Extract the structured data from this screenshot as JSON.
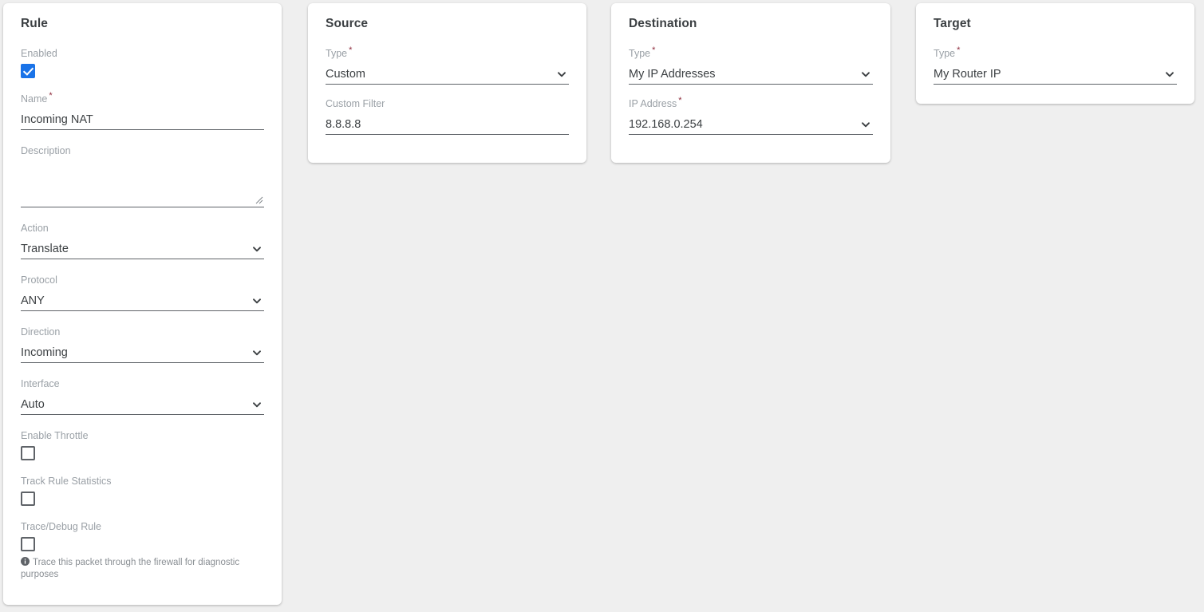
{
  "theme": {
    "page_background": "#efefef",
    "card_background": "#ffffff",
    "accent_checkbox": "#1a73e8",
    "label_color": "#9aa0a6",
    "value_color": "#3c4043",
    "required_asterisk": "#8e2b3c",
    "underline_color": "#5f6368"
  },
  "required_marker": "*",
  "cards": {
    "rule": {
      "title": "Rule",
      "enabled": {
        "label": "Enabled",
        "checked": true,
        "icon": "checkbox-checked-icon"
      },
      "name": {
        "label": "Name",
        "required": true,
        "value": "Incoming NAT"
      },
      "description": {
        "label": "Description",
        "required": false,
        "value": "",
        "resize_handle_icon": "resize-handle-icon"
      },
      "action": {
        "label": "Action",
        "required": false,
        "value": "Translate",
        "icon": "chevron-down-icon"
      },
      "protocol": {
        "label": "Protocol",
        "required": false,
        "value": "ANY",
        "icon": "chevron-down-icon"
      },
      "direction": {
        "label": "Direction",
        "required": false,
        "value": "Incoming",
        "icon": "chevron-down-icon"
      },
      "interface": {
        "label": "Interface",
        "required": false,
        "value": "Auto",
        "icon": "chevron-down-icon"
      },
      "enable_throttle": {
        "label": "Enable Throttle",
        "checked": false,
        "icon": "checkbox-unchecked-icon"
      },
      "track_rule_statistics": {
        "label": "Track Rule Statistics",
        "checked": false,
        "icon": "checkbox-unchecked-icon"
      },
      "trace_debug_rule": {
        "label": "Trace/Debug Rule",
        "checked": false,
        "icon": "checkbox-unchecked-icon",
        "hint": "Trace this packet through the firewall for diagnostic purposes",
        "hint_icon": "info-icon"
      }
    },
    "source": {
      "title": "Source",
      "type": {
        "label": "Type",
        "required": true,
        "value": "Custom",
        "icon": "chevron-down-icon"
      },
      "custom_filter": {
        "label": "Custom Filter",
        "required": false,
        "value": "8.8.8.8"
      }
    },
    "destination": {
      "title": "Destination",
      "type": {
        "label": "Type",
        "required": true,
        "value": "My IP Addresses",
        "icon": "chevron-down-icon"
      },
      "ip_address": {
        "label": "IP Address",
        "required": true,
        "value": "192.168.0.254",
        "icon": "chevron-down-icon"
      }
    },
    "target": {
      "title": "Target",
      "type": {
        "label": "Type",
        "required": true,
        "value": "My Router IP",
        "icon": "chevron-down-icon"
      }
    }
  }
}
